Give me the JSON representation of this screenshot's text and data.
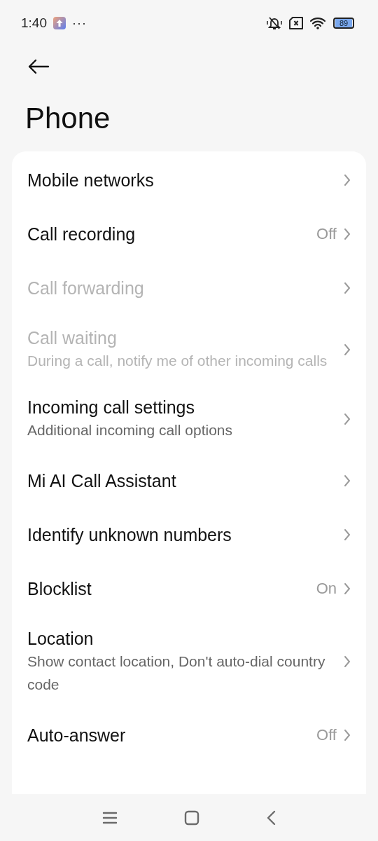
{
  "status_bar": {
    "time": "1:40",
    "more": "···",
    "battery": "89"
  },
  "header": {
    "title": "Phone"
  },
  "settings": [
    {
      "title": "Mobile networks",
      "disabled": false
    },
    {
      "title": "Call recording",
      "value": "Off",
      "disabled": false
    },
    {
      "title": "Call forwarding",
      "disabled": true
    },
    {
      "title": "Call waiting",
      "subtitle": "During a call, notify me of other incoming calls",
      "disabled": true
    },
    {
      "title": "Incoming call settings",
      "subtitle": "Additional incoming call options",
      "disabled": false
    },
    {
      "title": "Mi AI Call Assistant",
      "disabled": false
    },
    {
      "title": "Identify unknown numbers",
      "disabled": false
    },
    {
      "title": "Blocklist",
      "value": "On",
      "disabled": false
    },
    {
      "title": "Location",
      "subtitle": "Show contact location, Don't auto-dial country code",
      "disabled": false
    },
    {
      "title": "Auto-answer",
      "value": "Off",
      "disabled": false
    }
  ]
}
